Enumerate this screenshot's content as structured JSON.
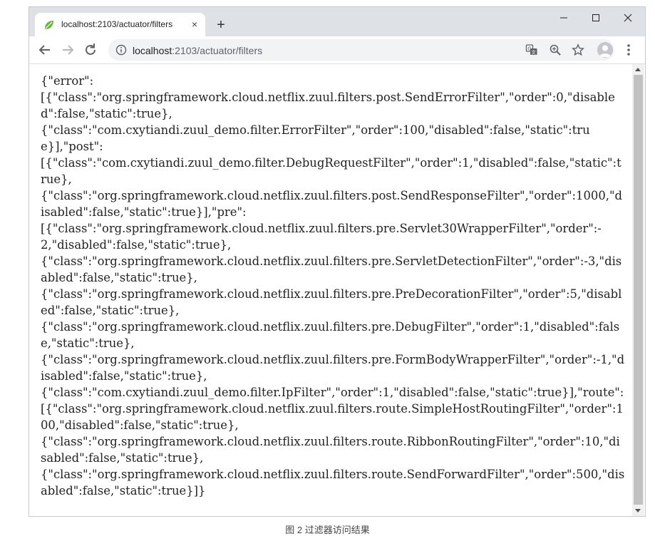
{
  "browser": {
    "tab_title": "localhost:2103/actuator/filters",
    "tab_close_label": "×",
    "new_tab_label": "+",
    "window_minimize": "–",
    "window_maximize": "☐",
    "window_close": "✕",
    "favicon": "leaf-icon",
    "url_host": "localhost",
    "url_rest": ":2103/actuator/filters",
    "accent": "#1a73e8",
    "tabstrip_color": "#dee1e6"
  },
  "content": {
    "text": "{\"error\":\n[{\"class\":\"org.springframework.cloud.netflix.zuul.filters.post.SendErrorFilter\",\"order\":0,\"disabled\":false,\"static\":true},\n{\"class\":\"com.cxytiandi.zuul_demo.filter.ErrorFilter\",\"order\":100,\"disabled\":false,\"static\":true}],\"post\":\n[{\"class\":\"com.cxytiandi.zuul_demo.filter.DebugRequestFilter\",\"order\":1,\"disabled\":false,\"static\":true},\n{\"class\":\"org.springframework.cloud.netflix.zuul.filters.post.SendResponseFilter\",\"order\":1000,\"disabled\":false,\"static\":true}],\"pre\":\n[{\"class\":\"org.springframework.cloud.netflix.zuul.filters.pre.Servlet30WrapperFilter\",\"order\":-2,\"disabled\":false,\"static\":true},\n{\"class\":\"org.springframework.cloud.netflix.zuul.filters.pre.ServletDetectionFilter\",\"order\":-3,\"disabled\":false,\"static\":true},\n{\"class\":\"org.springframework.cloud.netflix.zuul.filters.pre.PreDecorationFilter\",\"order\":5,\"disabled\":false,\"static\":true},\n{\"class\":\"org.springframework.cloud.netflix.zuul.filters.pre.DebugFilter\",\"order\":1,\"disabled\":false,\"static\":true},\n{\"class\":\"org.springframework.cloud.netflix.zuul.filters.pre.FormBodyWrapperFilter\",\"order\":-1,\"disabled\":false,\"static\":true},\n{\"class\":\"com.cxytiandi.zuul_demo.filter.IpFilter\",\"order\":1,\"disabled\":false,\"static\":true}],\"route\":\n[{\"class\":\"org.springframework.cloud.netflix.zuul.filters.route.SimpleHostRoutingFilter\",\"order\":100,\"disabled\":false,\"static\":true},\n{\"class\":\"org.springframework.cloud.netflix.zuul.filters.route.RibbonRoutingFilter\",\"order\":10,\"disabled\":false,\"static\":true},\n{\"class\":\"org.springframework.cloud.netflix.zuul.filters.route.SendForwardFilter\",\"order\":500,\"disabled\":false,\"static\":true}]}"
  },
  "caption": "图 2  过滤器访问结果"
}
